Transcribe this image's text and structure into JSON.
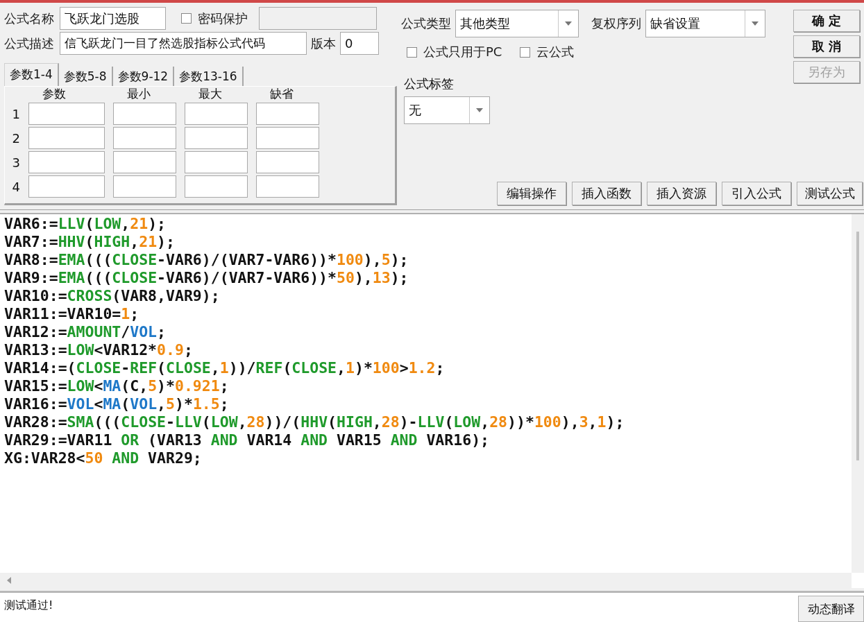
{
  "form": {
    "name_label": "公式名称",
    "name_value": "飞跃龙门选股",
    "password": {
      "label": "密码保护",
      "checked": false
    },
    "desc_label": "公式描述",
    "desc_value": "信飞跃龙门一目了然选股指标公式代码",
    "version_label": "版本",
    "version_value": "0"
  },
  "param_tabs": [
    {
      "label": "参数1-4",
      "selected": true
    },
    {
      "label": "参数5-8",
      "selected": false
    },
    {
      "label": "参数9-12",
      "selected": false
    },
    {
      "label": "参数13-16",
      "selected": false
    }
  ],
  "param_columns": [
    "参数",
    "最小",
    "最大",
    "缺省"
  ],
  "param_rows": [
    "1",
    "2",
    "3",
    "4"
  ],
  "formula_type": {
    "label": "公式类型",
    "value": "其他类型"
  },
  "rights_series": {
    "label": "复权序列",
    "value": "缺省设置"
  },
  "options": [
    {
      "label": "公式只用于PC",
      "checked": false
    },
    {
      "label": "云公式",
      "checked": false
    }
  ],
  "tag": {
    "label": "公式标签",
    "value": "无"
  },
  "side_buttons": [
    {
      "label": "确 定",
      "disabled": false
    },
    {
      "label": "取 消",
      "disabled": false
    },
    {
      "label": "另存为",
      "disabled": true
    }
  ],
  "tool_buttons": [
    "编辑操作",
    "插入函数",
    "插入资源",
    "引入公式",
    "测试公式"
  ],
  "code": [
    {
      "tokens": [
        {
          "kind": "plain",
          "text": "VAR6:="
        },
        {
          "kind": "func",
          "text": "LLV"
        },
        {
          "kind": "plain",
          "text": "("
        },
        {
          "kind": "func",
          "text": "LOW"
        },
        {
          "kind": "plain",
          "text": ","
        },
        {
          "kind": "number",
          "text": "21"
        },
        {
          "kind": "plain",
          "text": ");"
        }
      ]
    },
    {
      "tokens": [
        {
          "kind": "plain",
          "text": "VAR7:="
        },
        {
          "kind": "func",
          "text": "HHV"
        },
        {
          "kind": "plain",
          "text": "("
        },
        {
          "kind": "func",
          "text": "HIGH"
        },
        {
          "kind": "plain",
          "text": ","
        },
        {
          "kind": "number",
          "text": "21"
        },
        {
          "kind": "plain",
          "text": ");"
        }
      ]
    },
    {
      "tokens": [
        {
          "kind": "plain",
          "text": "VAR8:="
        },
        {
          "kind": "func",
          "text": "EMA"
        },
        {
          "kind": "plain",
          "text": "((("
        },
        {
          "kind": "func",
          "text": "CLOSE"
        },
        {
          "kind": "plain",
          "text": "-VAR6)/(VAR7-VAR6))*"
        },
        {
          "kind": "number",
          "text": "100"
        },
        {
          "kind": "plain",
          "text": "),"
        },
        {
          "kind": "number",
          "text": "5"
        },
        {
          "kind": "plain",
          "text": ");"
        }
      ]
    },
    {
      "tokens": [
        {
          "kind": "plain",
          "text": "VAR9:="
        },
        {
          "kind": "func",
          "text": "EMA"
        },
        {
          "kind": "plain",
          "text": "((("
        },
        {
          "kind": "func",
          "text": "CLOSE"
        },
        {
          "kind": "plain",
          "text": "-VAR6)/(VAR7-VAR6))*"
        },
        {
          "kind": "number",
          "text": "50"
        },
        {
          "kind": "plain",
          "text": "),"
        },
        {
          "kind": "number",
          "text": "13"
        },
        {
          "kind": "plain",
          "text": ");"
        }
      ]
    },
    {
      "tokens": [
        {
          "kind": "plain",
          "text": "VAR10:="
        },
        {
          "kind": "func",
          "text": "CROSS"
        },
        {
          "kind": "plain",
          "text": "(VAR8,VAR9);"
        }
      ]
    },
    {
      "tokens": [
        {
          "kind": "plain",
          "text": "VAR11:=VAR10="
        },
        {
          "kind": "number",
          "text": "1"
        },
        {
          "kind": "plain",
          "text": ";"
        }
      ]
    },
    {
      "tokens": [
        {
          "kind": "plain",
          "text": "VAR12:="
        },
        {
          "kind": "func",
          "text": "AMOUNT"
        },
        {
          "kind": "plain",
          "text": "/"
        },
        {
          "kind": "series",
          "text": "VOL"
        },
        {
          "kind": "plain",
          "text": ";"
        }
      ]
    },
    {
      "tokens": [
        {
          "kind": "plain",
          "text": "VAR13:="
        },
        {
          "kind": "func",
          "text": "LOW"
        },
        {
          "kind": "plain",
          "text": "<VAR12*"
        },
        {
          "kind": "number",
          "text": "0.9"
        },
        {
          "kind": "plain",
          "text": ";"
        }
      ]
    },
    {
      "tokens": [
        {
          "kind": "plain",
          "text": "VAR14:=("
        },
        {
          "kind": "func",
          "text": "CLOSE"
        },
        {
          "kind": "plain",
          "text": "-"
        },
        {
          "kind": "func",
          "text": "REF"
        },
        {
          "kind": "plain",
          "text": "("
        },
        {
          "kind": "func",
          "text": "CLOSE"
        },
        {
          "kind": "plain",
          "text": ","
        },
        {
          "kind": "number",
          "text": "1"
        },
        {
          "kind": "plain",
          "text": "))/"
        },
        {
          "kind": "func",
          "text": "REF"
        },
        {
          "kind": "plain",
          "text": "("
        },
        {
          "kind": "func",
          "text": "CLOSE"
        },
        {
          "kind": "plain",
          "text": ","
        },
        {
          "kind": "number",
          "text": "1"
        },
        {
          "kind": "plain",
          "text": ")*"
        },
        {
          "kind": "number",
          "text": "100"
        },
        {
          "kind": "plain",
          "text": ">"
        },
        {
          "kind": "number",
          "text": "1.2"
        },
        {
          "kind": "plain",
          "text": ";"
        }
      ]
    },
    {
      "tokens": [
        {
          "kind": "plain",
          "text": "VAR15:="
        },
        {
          "kind": "func",
          "text": "LOW"
        },
        {
          "kind": "plain",
          "text": "<"
        },
        {
          "kind": "series",
          "text": "MA"
        },
        {
          "kind": "plain",
          "text": "(C,"
        },
        {
          "kind": "number",
          "text": "5"
        },
        {
          "kind": "plain",
          "text": ")*"
        },
        {
          "kind": "number",
          "text": "0.921"
        },
        {
          "kind": "plain",
          "text": ";"
        }
      ]
    },
    {
      "tokens": [
        {
          "kind": "plain",
          "text": "VAR16:="
        },
        {
          "kind": "series",
          "text": "VOL"
        },
        {
          "kind": "plain",
          "text": "<"
        },
        {
          "kind": "series",
          "text": "MA"
        },
        {
          "kind": "plain",
          "text": "("
        },
        {
          "kind": "series",
          "text": "VOL"
        },
        {
          "kind": "plain",
          "text": ","
        },
        {
          "kind": "number",
          "text": "5"
        },
        {
          "kind": "plain",
          "text": ")*"
        },
        {
          "kind": "number",
          "text": "1.5"
        },
        {
          "kind": "plain",
          "text": ";"
        }
      ]
    },
    {
      "tokens": [
        {
          "kind": "plain",
          "text": "VAR28:="
        },
        {
          "kind": "func",
          "text": "SMA"
        },
        {
          "kind": "plain",
          "text": "((("
        },
        {
          "kind": "func",
          "text": "CLOSE"
        },
        {
          "kind": "plain",
          "text": "-"
        },
        {
          "kind": "func",
          "text": "LLV"
        },
        {
          "kind": "plain",
          "text": "("
        },
        {
          "kind": "func",
          "text": "LOW"
        },
        {
          "kind": "plain",
          "text": ","
        },
        {
          "kind": "number",
          "text": "28"
        },
        {
          "kind": "plain",
          "text": "))/("
        },
        {
          "kind": "func",
          "text": "HHV"
        },
        {
          "kind": "plain",
          "text": "("
        },
        {
          "kind": "func",
          "text": "HIGH"
        },
        {
          "kind": "plain",
          "text": ","
        },
        {
          "kind": "number",
          "text": "28"
        },
        {
          "kind": "plain",
          "text": ")-"
        },
        {
          "kind": "func",
          "text": "LLV"
        },
        {
          "kind": "plain",
          "text": "("
        },
        {
          "kind": "func",
          "text": "LOW"
        },
        {
          "kind": "plain",
          "text": ","
        },
        {
          "kind": "number",
          "text": "28"
        },
        {
          "kind": "plain",
          "text": "))*"
        },
        {
          "kind": "number",
          "text": "100"
        },
        {
          "kind": "plain",
          "text": "),"
        },
        {
          "kind": "number",
          "text": "3"
        },
        {
          "kind": "plain",
          "text": ","
        },
        {
          "kind": "number",
          "text": "1"
        },
        {
          "kind": "plain",
          "text": ");"
        }
      ]
    },
    {
      "tokens": [
        {
          "kind": "plain",
          "text": "VAR29:=VAR11 "
        },
        {
          "kind": "func",
          "text": "OR"
        },
        {
          "kind": "plain",
          "text": " (VAR13 "
        },
        {
          "kind": "func",
          "text": "AND"
        },
        {
          "kind": "plain",
          "text": " VAR14 "
        },
        {
          "kind": "func",
          "text": "AND"
        },
        {
          "kind": "plain",
          "text": " VAR15 "
        },
        {
          "kind": "func",
          "text": "AND"
        },
        {
          "kind": "plain",
          "text": " VAR16);"
        }
      ]
    },
    {
      "tokens": [
        {
          "kind": "plain",
          "text": "XG:VAR28<"
        },
        {
          "kind": "number",
          "text": "50"
        },
        {
          "kind": "func",
          "text": " AND"
        },
        {
          "kind": "plain",
          "text": " VAR29;"
        }
      ]
    }
  ],
  "status": {
    "message": "测试通过!",
    "button": "动态翻译"
  }
}
